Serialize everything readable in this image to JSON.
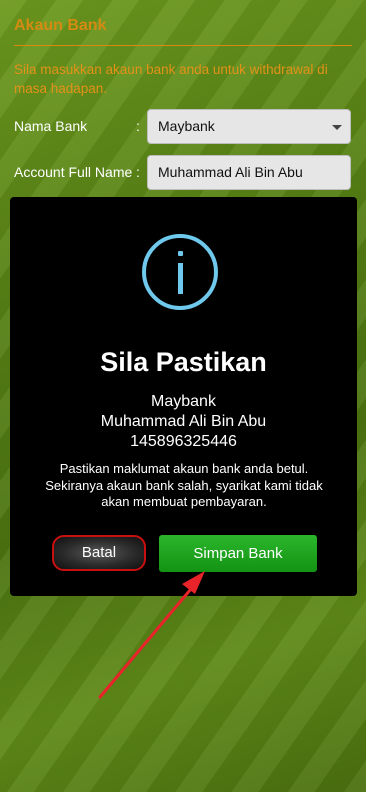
{
  "page": {
    "title": "Akaun Bank",
    "intro": "Sila masukkan akaun bank anda untuk withdrawal di masa hadapan.",
    "fields": {
      "bank_name_label": "Nama Bank",
      "colon": ":",
      "bank_name_value": "Maybank",
      "full_name_label": "Account Full Name",
      "full_name_value": "Muhammad Ali Bin Abu"
    }
  },
  "modal": {
    "icon": "info-icon",
    "title": "Sila Pastikan",
    "bank": "Maybank",
    "account_name": "Muhammad Ali Bin Abu",
    "account_number": "145896325446",
    "warning": "Pastikan maklumat akaun bank anda betul. Sekiranya akaun bank salah, syarikat kami tidak akan membuat pembayaran.",
    "cancel_label": "Batal",
    "confirm_label": "Simpan Bank"
  },
  "colors": {
    "accent_orange": "#d58b12",
    "info_blue": "#6fc9ec",
    "confirm_green": "#139313",
    "cancel_red_border": "#c81010",
    "annotation_arrow": "#e8232a"
  }
}
